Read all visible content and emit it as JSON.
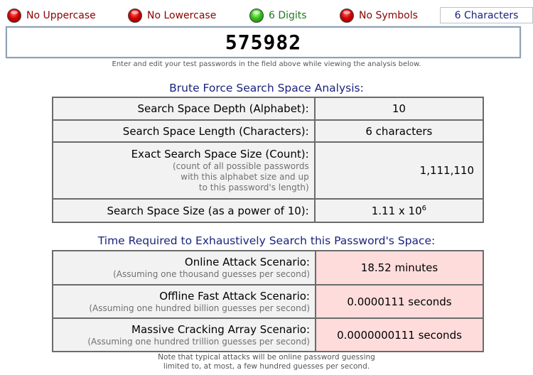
{
  "indicators": [
    {
      "label": "No Uppercase",
      "state": "red"
    },
    {
      "label": "No Lowercase",
      "state": "red"
    },
    {
      "label": "6 Digits",
      "state": "green"
    },
    {
      "label": "No Symbols",
      "state": "red"
    }
  ],
  "char_count": "6 Characters",
  "password": "575982",
  "hint": "Enter and edit your test passwords in the field above while viewing the analysis below.",
  "search_space": {
    "title": "Brute Force Search Space Analysis:",
    "depth_label": "Search Space Depth (Alphabet):",
    "depth_value": "10",
    "length_label": "Search Space Length (Characters):",
    "length_value": "6 characters",
    "exact_label": "Exact Search Space Size (Count):",
    "exact_sub_1": "(count of all possible passwords",
    "exact_sub_2": "with this alphabet size and up",
    "exact_sub_3": "to this password's length)",
    "exact_value": "1,111,110",
    "power_label": "Search Space Size (as a power of 10):",
    "power_mantissa": "1.11 x 10",
    "power_exponent": "6"
  },
  "time": {
    "title": "Time Required to Exhaustively Search this Password's Space:",
    "online_label": "Online Attack Scenario:",
    "online_sub": "(Assuming one thousand guesses per second)",
    "online_value": "18.52 minutes",
    "offline_label": "Offline Fast Attack Scenario:",
    "offline_sub": "(Assuming one hundred billion guesses per second)",
    "offline_value": "0.0000111 seconds",
    "massive_label": "Massive Cracking Array Scenario:",
    "massive_sub": "(Assuming one hundred trillion guesses per second)",
    "massive_value": "0.0000000111 seconds"
  },
  "footnote_1": "Note that typical attacks will be online password guessing",
  "footnote_2": "limited to, at most, a few hundred guesses per second."
}
